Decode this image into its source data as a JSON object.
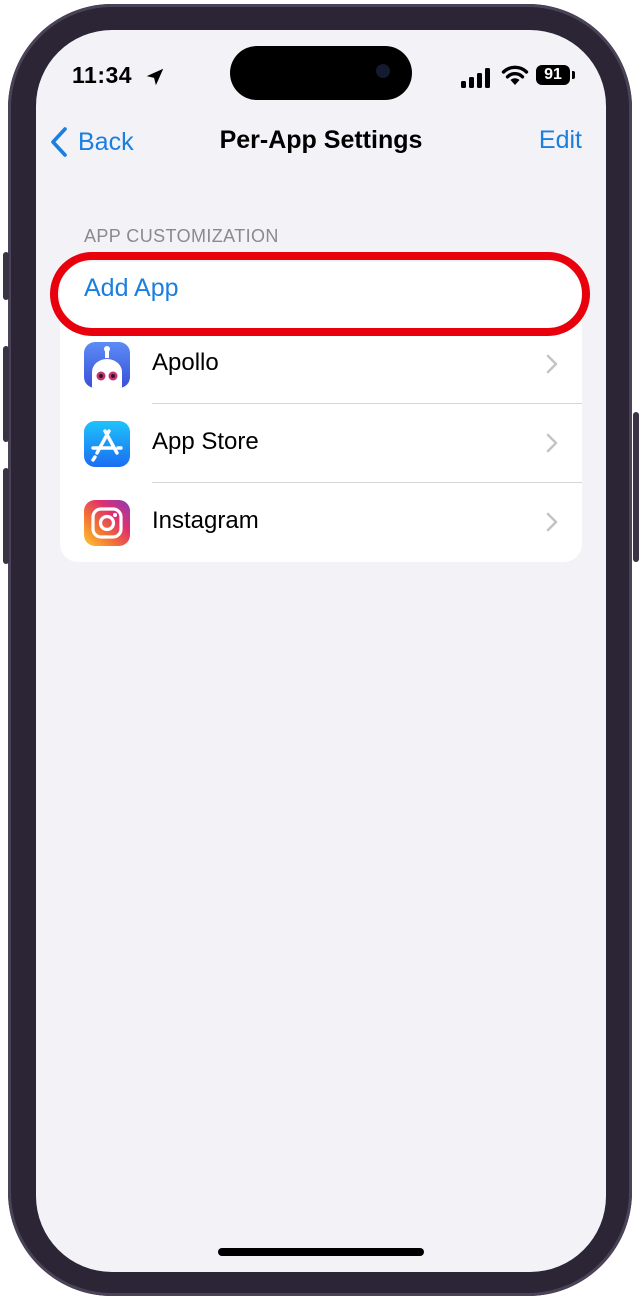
{
  "status_bar": {
    "time": "11:34",
    "battery": "91",
    "icons": [
      "location-arrow-icon",
      "cellular-signal-icon",
      "wifi-icon",
      "battery-icon"
    ]
  },
  "nav": {
    "back_label": "Back",
    "title": "Per-App Settings",
    "edit_label": "Edit"
  },
  "section": {
    "header": "APP CUSTOMIZATION",
    "add_label": "Add App",
    "apps": [
      {
        "label": "Apollo",
        "icon": "apollo-app-icon"
      },
      {
        "label": "App Store",
        "icon": "app-store-icon"
      },
      {
        "label": "Instagram",
        "icon": "instagram-icon"
      }
    ]
  },
  "colors": {
    "accent": "#1a7fe0",
    "highlight": "#e8000d",
    "background": "#f2f2f7"
  }
}
